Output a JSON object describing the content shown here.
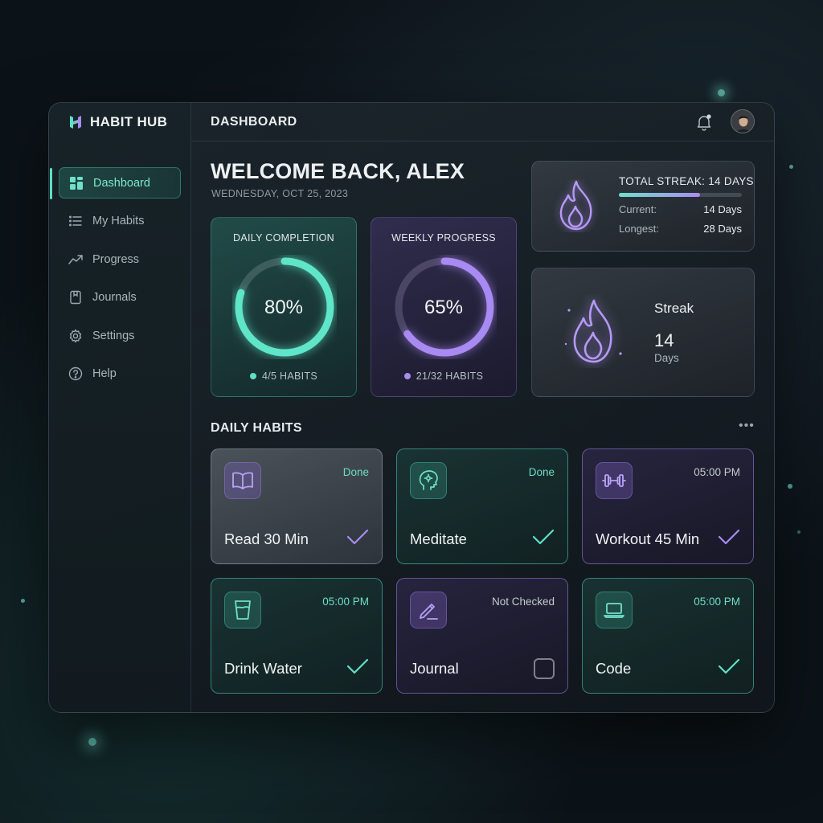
{
  "app": {
    "name": "HABIT HUB",
    "logo_icon": "habit-hub-logo-icon"
  },
  "colors": {
    "teal": "#5fe0c5",
    "purple": "#a98cf0",
    "background": "#0c1318"
  },
  "sidebar": {
    "items": [
      {
        "label": "Dashboard",
        "icon": "grid-icon",
        "active": true
      },
      {
        "label": "My Habits",
        "icon": "list-icon",
        "active": false
      },
      {
        "label": "Progress",
        "icon": "trend-icon",
        "active": false
      },
      {
        "label": "Journals",
        "icon": "journal-icon",
        "active": false
      },
      {
        "label": "Settings",
        "icon": "gear-icon",
        "active": false
      },
      {
        "label": "Help",
        "icon": "help-icon",
        "active": false
      }
    ]
  },
  "header": {
    "title": "DASHBOARD",
    "notification_icon": "bell-icon",
    "has_notification": true
  },
  "welcome": {
    "heading": "WELCOME BACK, ALEX",
    "date": "WEDNESDAY, OCT 25, 2023"
  },
  "daily_completion": {
    "title": "DAILY COMPLETION",
    "percent_label": "80%",
    "percent": 80,
    "footer": "4/5 HABITS"
  },
  "weekly_progress": {
    "title": "WEEKLY PROGRESS",
    "percent_label": "65%",
    "percent": 65,
    "footer": "21/32 HABITS"
  },
  "total_streak": {
    "title": "TOTAL STREAK: 14 DAYS",
    "progress_fraction": 0.66,
    "current_label": "Current:",
    "current_value": "14 Days",
    "longest_label": "Longest:",
    "longest_value": "28 Days"
  },
  "streak": {
    "label": "Streak",
    "number": "14",
    "unit": "Days"
  },
  "daily_habits": {
    "title": "DAILY HABITS",
    "more": "•••",
    "items": [
      {
        "name": "Read 30 Min",
        "status": "Done",
        "icon": "book-icon",
        "checked": true
      },
      {
        "name": "Meditate",
        "status": "Done",
        "icon": "brain-icon",
        "checked": true
      },
      {
        "name": "Workout 45 Min",
        "status": "05:00 PM",
        "icon": "dumbbell-icon",
        "checked": true
      },
      {
        "name": "Drink Water",
        "status": "05:00 PM",
        "icon": "glass-icon",
        "checked": true
      },
      {
        "name": "Journal",
        "status": "Not Checked",
        "icon": "pen-icon",
        "checked": false
      },
      {
        "name": "Code",
        "status": "05:00 PM",
        "icon": "laptop-icon",
        "checked": true
      }
    ]
  }
}
